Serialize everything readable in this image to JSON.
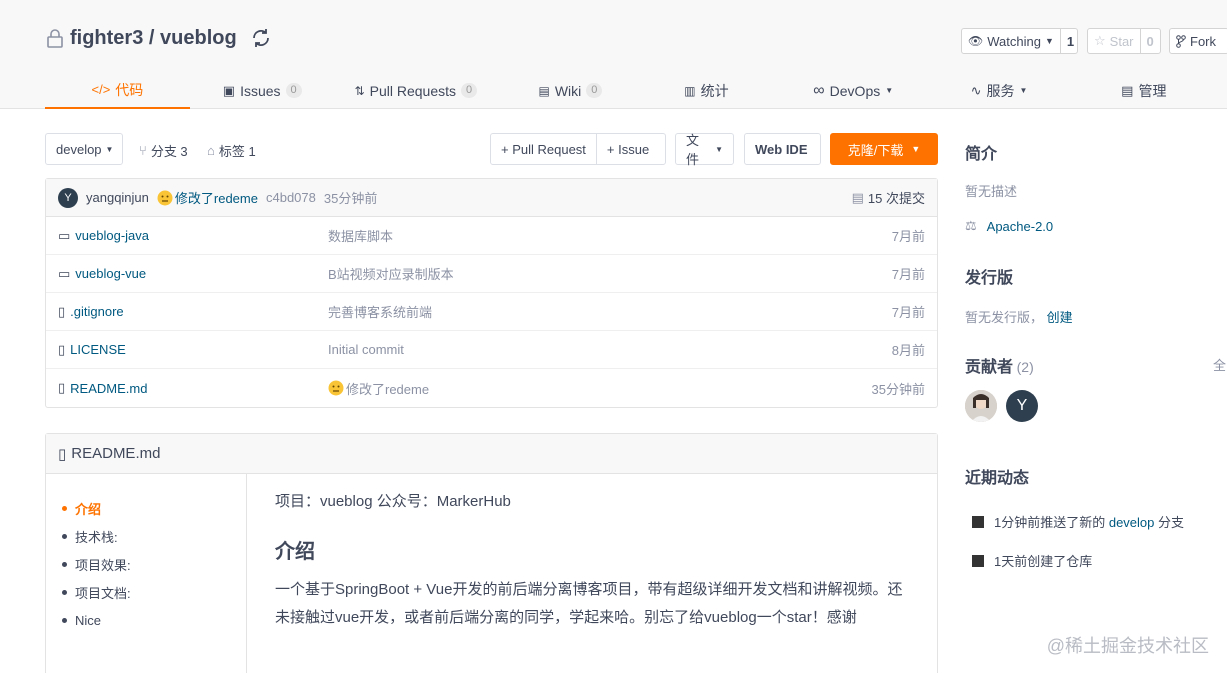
{
  "repo": {
    "owner_repo": "fighter3 / vueblog"
  },
  "header_buttons": {
    "watch": {
      "label": "Watching",
      "count": "1"
    },
    "star": {
      "label": "Star",
      "count": "0"
    },
    "fork": {
      "label": "Fork"
    }
  },
  "tabs": [
    {
      "label": "代码",
      "badge": null
    },
    {
      "label": "Issues",
      "badge": "0"
    },
    {
      "label": "Pull Requests",
      "badge": "0"
    },
    {
      "label": "Wiki",
      "badge": "0"
    },
    {
      "label": "统计",
      "badge": null
    },
    {
      "label": "DevOps",
      "badge": null
    },
    {
      "label": "服务",
      "badge": null
    },
    {
      "label": "管理",
      "badge": null
    }
  ],
  "toolbar": {
    "branch": "develop",
    "branches": "分支 3",
    "tags": "标签 1",
    "pull_request": "+ Pull Request",
    "issue": "+ Issue",
    "file": "文件",
    "web_ide": "Web IDE",
    "clone": "克隆/下载"
  },
  "commit": {
    "avatar_letter": "Y",
    "author": "yangqinjun",
    "message": "修改了redeme",
    "hash": "c4bd078",
    "time": "35分钟前",
    "commits": "15 次提交"
  },
  "files": [
    {
      "name": "vueblog-java",
      "type": "folder",
      "message": "数据库脚本",
      "time": "7月前"
    },
    {
      "name": "vueblog-vue",
      "type": "folder",
      "message": "B站视频对应录制版本",
      "time": "7月前"
    },
    {
      "name": ".gitignore",
      "type": "file",
      "message": "完善博客系统前端",
      "time": "7月前"
    },
    {
      "name": "LICENSE",
      "type": "file",
      "message": "Initial commit",
      "time": "8月前"
    },
    {
      "name": "README.md",
      "type": "file",
      "message": "修改了redeme",
      "time": "35分钟前"
    }
  ],
  "readme": {
    "title": "README.md",
    "toc": [
      "介绍",
      "技术栈:",
      "项目效果:",
      "项目文档:",
      "Nice"
    ],
    "line1": "项目：vueblog 公众号：MarkerHub",
    "heading": "介绍",
    "paragraph": "一个基于SpringBoot + Vue开发的前后端分离博客项目，带有超级详细开发文档和讲解视频。还未接触过vue开发，或者前后端分离的同学，学起来哈。别忘了给vueblog一个star！感谢"
  },
  "sidebar": {
    "intro_title": "简介",
    "intro_desc": "暂无描述",
    "license": "Apache-2.0",
    "release_title": "发行版",
    "release_desc": "暂无发行版，",
    "release_create": "创建",
    "contrib_title": "贡献者",
    "contrib_count": "(2)",
    "contrib_all": "全",
    "contrib_avatar_letter": "Y",
    "activity_title": "近期动态",
    "activity": [
      {
        "prefix": "1分钟前推送了新的 ",
        "link": "develop",
        "suffix": " 分支"
      },
      {
        "prefix": "1天前创建了仓库",
        "link": "",
        "suffix": ""
      }
    ]
  },
  "watermark": "@稀土掘金技术社区",
  "colors": {
    "accent": "#fe7300",
    "link": "#005980",
    "avatar": "#2e3f4f"
  }
}
